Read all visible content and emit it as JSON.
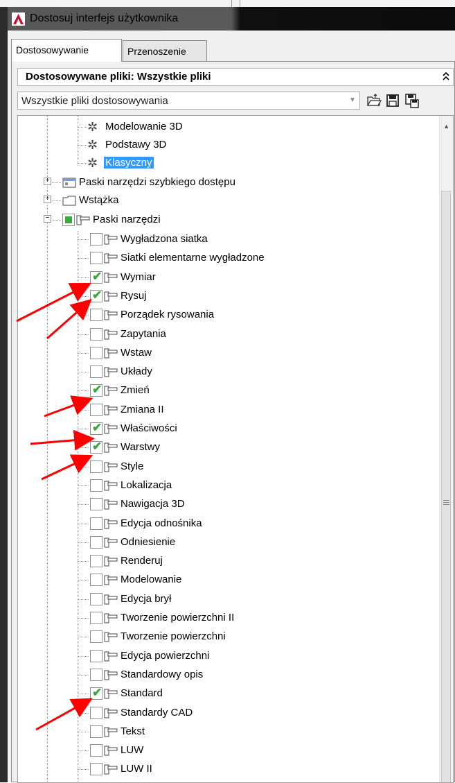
{
  "window": {
    "title": "Dostosuj interfejs użytkownika"
  },
  "tabs": [
    {
      "label": "Dostosowywanie",
      "active": true
    },
    {
      "label": "Przenoszenie",
      "active": false
    }
  ],
  "section": {
    "title": "Dostosowywane pliki: Wszystkie pliki",
    "collapse_glyph": "⌃⌃"
  },
  "combo": {
    "value": "Wszystkie pliki dostosowywania"
  },
  "toolbar_icons": [
    "open-file-icon",
    "save-icon",
    "save-as-icon"
  ],
  "tree": {
    "workspaces": [
      {
        "label": "Modelowanie 3D",
        "selected": false
      },
      {
        "label": "Podstawy 3D",
        "selected": false
      },
      {
        "label": "Klasyczny",
        "selected": true
      }
    ],
    "nodes": [
      {
        "label": "Paski narzędzi szybkiego dostępu",
        "expander": "+"
      },
      {
        "label": "Wstążka",
        "expander": "+"
      },
      {
        "label": "Paski narzędzi",
        "expander": "−"
      }
    ],
    "toolbars": [
      {
        "label": "Wygładzona siatka",
        "checked": false
      },
      {
        "label": "Siatki elementarne wygładzone",
        "checked": false
      },
      {
        "label": "Wymiar",
        "checked": true
      },
      {
        "label": "Rysuj",
        "checked": true
      },
      {
        "label": "Porządek rysowania",
        "checked": false
      },
      {
        "label": "Zapytania",
        "checked": false
      },
      {
        "label": "Wstaw",
        "checked": false
      },
      {
        "label": "Układy",
        "checked": false
      },
      {
        "label": "Zmień",
        "checked": true
      },
      {
        "label": "Zmiana II",
        "checked": false
      },
      {
        "label": "Właściwości",
        "checked": true
      },
      {
        "label": "Warstwy",
        "checked": true
      },
      {
        "label": "Style",
        "checked": false
      },
      {
        "label": "Lokalizacja",
        "checked": false
      },
      {
        "label": "Nawigacja 3D",
        "checked": false
      },
      {
        "label": "Edycja odnośnika",
        "checked": false
      },
      {
        "label": "Odniesienie",
        "checked": false
      },
      {
        "label": "Renderuj",
        "checked": false
      },
      {
        "label": "Modelowanie",
        "checked": false
      },
      {
        "label": "Edycja brył",
        "checked": false
      },
      {
        "label": "Tworzenie powierzchni II",
        "checked": false
      },
      {
        "label": "Tworzenie powierzchni",
        "checked": false
      },
      {
        "label": "Edycja powierzchni",
        "checked": false
      },
      {
        "label": "Standardowy opis",
        "checked": false
      },
      {
        "label": "Standard",
        "checked": true
      },
      {
        "label": "Standardy CAD",
        "checked": false
      },
      {
        "label": "Tekst",
        "checked": false
      },
      {
        "label": "LUW",
        "checked": false
      },
      {
        "label": "LUW II",
        "checked": false
      }
    ]
  },
  "colors": {
    "check": "#3aa83a",
    "selection": "#3399ff",
    "arrow": "#ff0000",
    "app_icon": "#c8102e"
  }
}
